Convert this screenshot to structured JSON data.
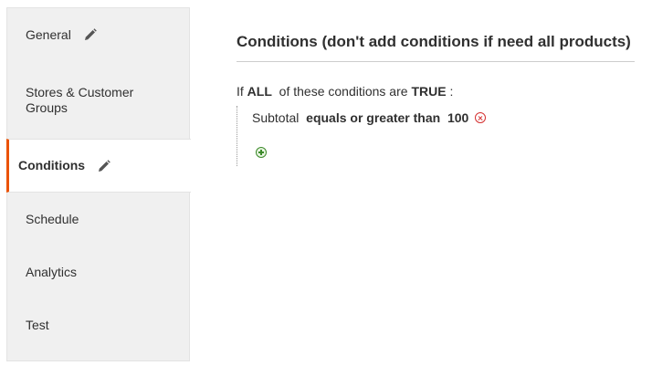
{
  "sidebar": {
    "items": [
      {
        "label": "General",
        "edited": true
      },
      {
        "label": "Stores & Customer Groups",
        "edited": false
      },
      {
        "label": "Conditions",
        "edited": true,
        "active": true
      },
      {
        "label": "Schedule",
        "edited": false
      },
      {
        "label": "Analytics",
        "edited": false
      },
      {
        "label": "Test",
        "edited": false
      }
    ]
  },
  "main": {
    "title": "Conditions (don't add conditions if need all products)",
    "rule": {
      "prefix": "If",
      "aggregator": "ALL",
      "middle": "of these conditions are",
      "value": "TRUE",
      "suffix": ":"
    },
    "condition": {
      "attribute": "Subtotal",
      "operator": "equals or greater than",
      "value": "100"
    }
  },
  "icons": {
    "edit": "pencil-icon",
    "remove": "remove-condition-icon",
    "add": "add-condition-icon"
  },
  "colors": {
    "accent": "#eb5202",
    "sidebar_bg": "#f0f0f0",
    "remove": "#d42f2f",
    "add": "#3d8a2b"
  }
}
